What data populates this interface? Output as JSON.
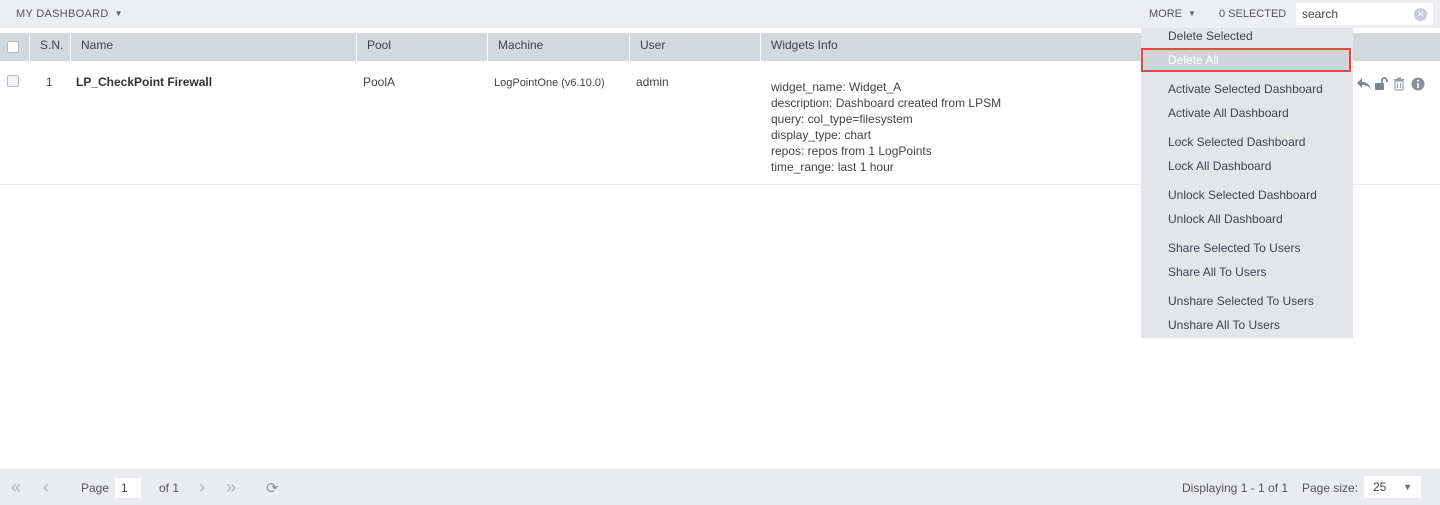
{
  "topbar": {
    "title": "MY DASHBOARD",
    "more_label": "MORE",
    "selected_label": "0 SELECTED",
    "search_placeholder": "search"
  },
  "table": {
    "columns": [
      "S.N.",
      "Name",
      "Pool",
      "Machine",
      "User",
      "Widgets Info"
    ],
    "rows": [
      {
        "sn": "1",
        "name": "LP_CheckPoint Firewall",
        "pool": "PoolA",
        "machine": "LogPointOne (v6.10.0)",
        "user": "admin",
        "widgets_info": [
          "widget_name: Widget_A",
          "description: Dashboard created from LPSM",
          "query: col_type=filesystem",
          "display_type: chart",
          "repos: repos from 1 LogPoints",
          "time_range: last 1 hour"
        ]
      }
    ]
  },
  "more_menu": {
    "items": [
      "Delete Selected",
      "Delete All",
      "Activate Selected Dashboard",
      "Activate All Dashboard",
      "Lock Selected Dashboard",
      "Lock All Dashboard",
      "Unlock Selected Dashboard",
      "Unlock All Dashboard",
      "Share Selected To Users",
      "Share All To Users",
      "Unshare Selected To Users",
      "Unshare All To Users"
    ],
    "active_item": "Delete All"
  },
  "footer": {
    "page_label": "Page",
    "page_value": "1",
    "of_label": "of 1",
    "displaying": "Displaying 1 - 1 of 1",
    "page_size_label": "Page size:",
    "page_size_value": "25"
  },
  "colors": {
    "topbar_bg": "#eceef2",
    "header_bg": "#d3d7de",
    "menu_bg": "#e3e5e9",
    "highlight_border": "#e34a3a"
  }
}
